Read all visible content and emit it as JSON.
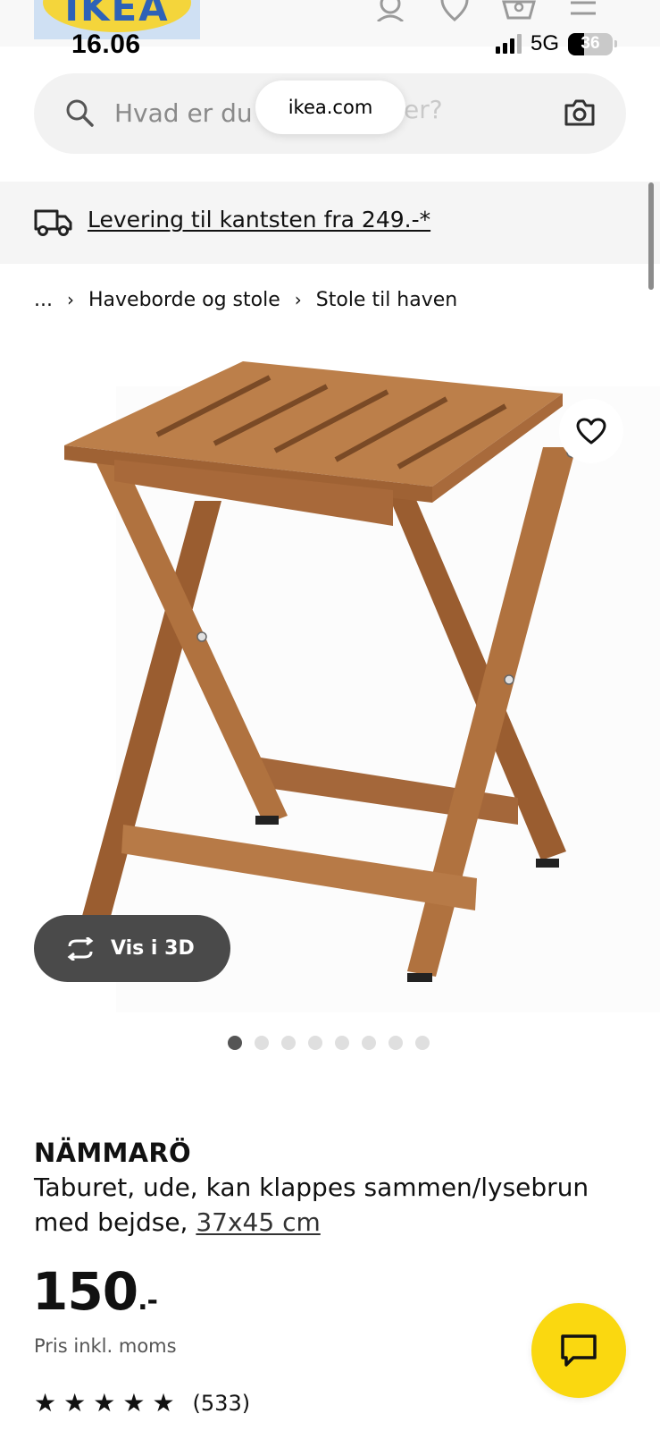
{
  "header": {
    "logo_text": "IKEA",
    "icons": [
      "profile-icon",
      "heart-icon",
      "basket-icon",
      "menu-icon"
    ]
  },
  "status_bar": {
    "time": "16.06",
    "network": "5G",
    "battery": "36",
    "signal_bars_active": 3,
    "signal_bars_total": 4
  },
  "search": {
    "placeholder": "Hvad er du på udkig efter?",
    "visible_left": "Hvad er du",
    "visible_right": "ter?",
    "url": "ikea.com"
  },
  "delivery_banner": {
    "text": "Levering til kantsten fra 249.-*"
  },
  "breadcrumb": {
    "items": [
      "...",
      "Haveborde og stole",
      "Stole til haven"
    ]
  },
  "gallery": {
    "view_3d_label": "Vis i 3D",
    "image_count": 8,
    "active_index": 0
  },
  "product": {
    "name": "NÄMMARÖ",
    "description": "Taburet, ude, kan klappes sammen/lysebrun med bejdse,",
    "size": "37x45 cm",
    "price_integer": "150",
    "price_decimal": ".-",
    "price_note": "Pris inkl. moms",
    "rating": 5,
    "review_count": "(533)"
  },
  "colors": {
    "accent_yellow": "#fad810",
    "brand_blue": "#2e62b7",
    "wood": "#a8693a"
  }
}
